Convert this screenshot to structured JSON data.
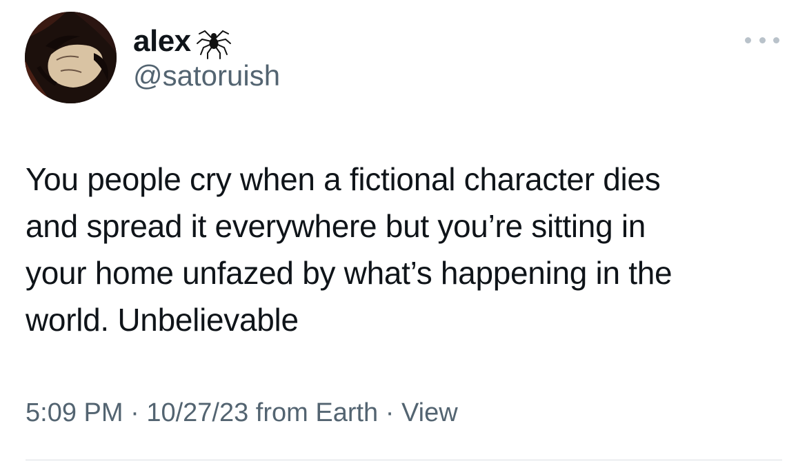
{
  "author": {
    "display_name": "alex",
    "name_emoji_icon": "spider-icon",
    "handle": "@satoruish",
    "avatar_icon": "avatar-portrait"
  },
  "more_icon": "more-dots-icon",
  "tweet": {
    "lines": [
      "You people cry when a fictional character dies",
      "and spread it everywhere but you’re sitting in",
      "your home unfazed by what’s happening in the",
      "world. Unbelievable"
    ]
  },
  "meta": {
    "time": "5:09 PM",
    "separator": "·",
    "date": "10/27/23",
    "source": "from Earth",
    "view_label": "View"
  },
  "colors": {
    "text": "#0f1419",
    "secondary": "#536471",
    "divider": "#d9dee2"
  }
}
